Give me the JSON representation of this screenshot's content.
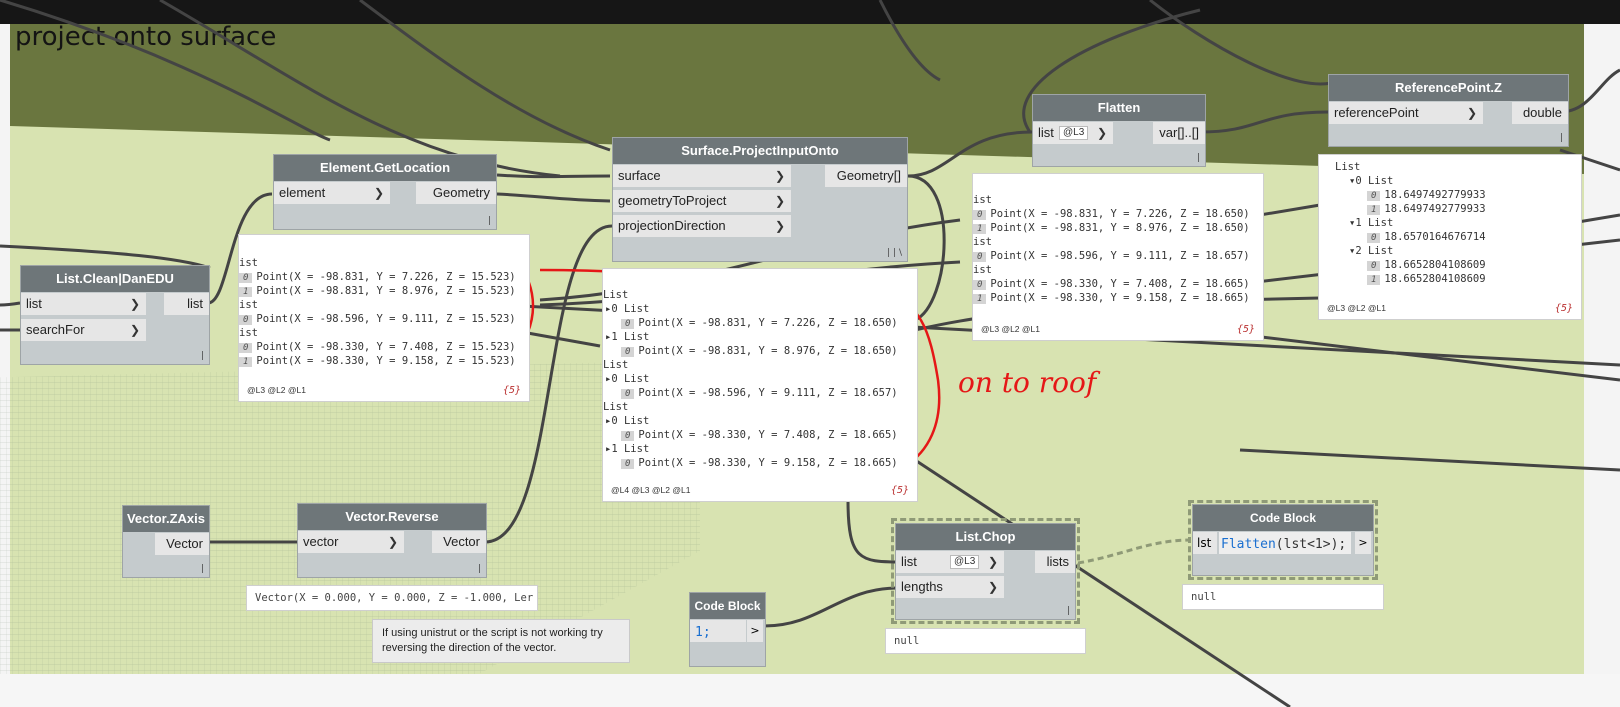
{
  "group": {
    "title": "project onto surface"
  },
  "annotation": {
    "text": "on to roof"
  },
  "nodes": {
    "list_clean": {
      "title": "List.Clean|DanEDU",
      "in1": "list",
      "in2": "searchFor",
      "out1": "list"
    },
    "get_location": {
      "title": "Element.GetLocation",
      "in1": "element",
      "out1": "Geometry"
    },
    "project": {
      "title": "Surface.ProjectInputOnto",
      "in1": "surface",
      "in2": "geometryToProject",
      "in3": "projectionDirection",
      "out1": "Geometry[]",
      "corner": "| | \\"
    },
    "flatten": {
      "title": "Flatten",
      "in1": "list",
      "lace": "@L3",
      "out1": "var[]..[]"
    },
    "refz": {
      "title": "ReferencePoint.Z",
      "in1": "referencePoint",
      "out1": "double"
    },
    "zaxis": {
      "title": "Vector.ZAxis",
      "out1": "Vector"
    },
    "reverse": {
      "title": "Vector.Reverse",
      "in1": "vector",
      "out1": "Vector"
    },
    "chop": {
      "title": "List.Chop",
      "in1": "list",
      "lace": "@L3",
      "in2": "lengths",
      "out1": "lists"
    },
    "cb1": {
      "title": "Code Block",
      "code": "1;",
      "out": ">"
    },
    "cb2": {
      "title": "Code Block",
      "port": "lst",
      "code_fn": "Flatten",
      "code_args": "(lst<1>);",
      "out": ">"
    }
  },
  "previews": {
    "get_location": {
      "lines": [
        "ist",
        "Point(X = -98.831, Y = 7.226, Z = 15.523)",
        "Point(X = -98.831, Y = 8.976, Z = 15.523)",
        "ist",
        "Point(X = -98.596, Y = 9.111, Z = 15.523)",
        "ist",
        "Point(X = -98.330, Y = 7.408, Z = 15.523)",
        "Point(X = -98.330, Y = 9.158, Z = 15.523)"
      ],
      "idx": [
        "0",
        "1",
        "0",
        "0",
        "1"
      ],
      "foot": "@L3 @L2 @L1",
      "count": "{5}"
    },
    "project": {
      "list": "List",
      "sub": "List",
      "lines": [
        "Point(X = -98.831, Y = 7.226, Z = 18.650)",
        "Point(X = -98.831, Y = 8.976, Z = 18.650)",
        "Point(X = -98.596, Y = 9.111, Z = 18.657)",
        "Point(X = -98.330, Y = 7.408, Z = 18.665)",
        "Point(X = -98.330, Y = 9.158, Z = 18.665)"
      ],
      "idx": [
        "0",
        "1"
      ],
      "foot": "@L4 @L3 @L2 @L1",
      "count": "{5}"
    },
    "flatten": {
      "lines": [
        "ist",
        "Point(X = -98.831, Y = 7.226, Z = 18.650)",
        "Point(X = -98.831, Y = 8.976, Z = 18.650)",
        "ist",
        "Point(X = -98.596, Y = 9.111, Z = 18.657)",
        "ist",
        "Point(X = -98.330, Y = 7.408, Z = 18.665)",
        "Point(X = -98.330, Y = 9.158, Z = 18.665)"
      ],
      "idx": [
        "0",
        "1",
        "0",
        "0",
        "1"
      ],
      "foot": "@L3 @L2 @L1",
      "count": "{5}"
    },
    "refz": {
      "list": "List",
      "sub": "List",
      "v1": "18.6497492779933",
      "v2": "18.6497492779933",
      "v3": "18.6570164676714",
      "v4": "18.6652804108609",
      "v5": "18.6652804108609",
      "i0": "0",
      "i1": "1",
      "i2": "2",
      "foot": "@L3 @L2 @L1",
      "count": "{5}"
    },
    "reverse": "Vector(X = 0.000, Y = 0.000, Z = -1.000, Ler",
    "chop": "null",
    "cb2": "null"
  },
  "note": {
    "text": "If using unistrut or the script is not working try reversing the direction of the vector."
  },
  "colors": {
    "annotation": "#e51717",
    "header": "#6e7679",
    "group": "#d8e3b1",
    "olive": "#6a763f"
  }
}
